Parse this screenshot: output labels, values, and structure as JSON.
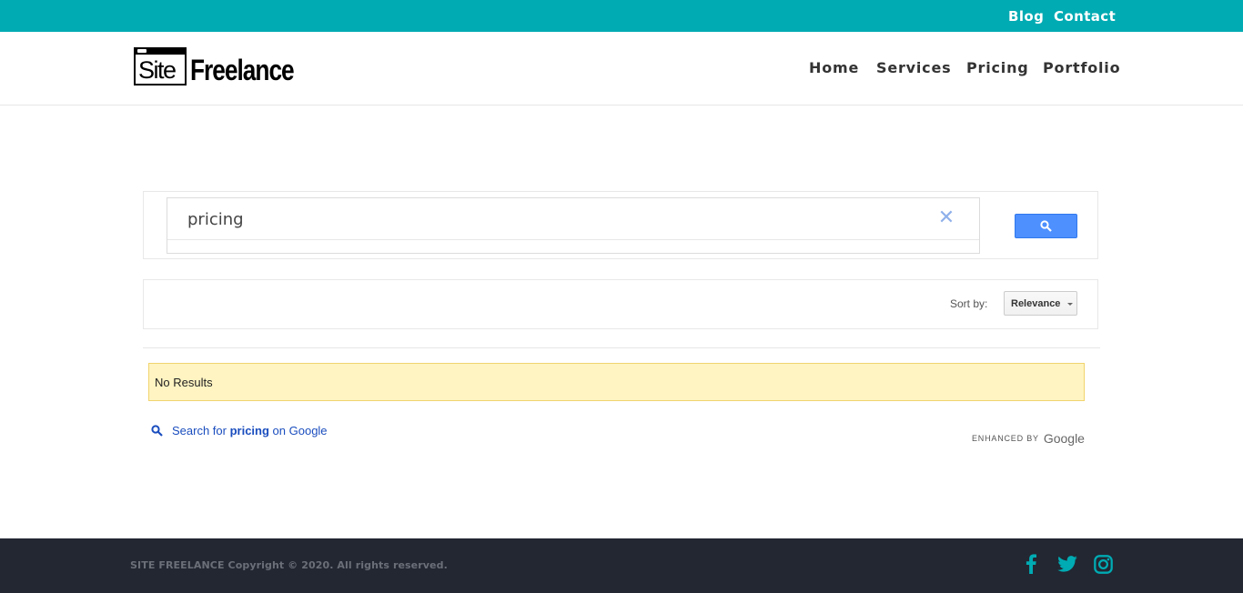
{
  "topbar": {
    "blog": "Blog",
    "contact": "Contact"
  },
  "logo": {
    "site": "Site",
    "freelance": "Freelance"
  },
  "nav": {
    "home": "Home",
    "services": "Services",
    "pricing": "Pricing",
    "portfolio": "Portfolio"
  },
  "search": {
    "value": "pricing",
    "clear_icon": "close-icon",
    "button_icon": "search-icon"
  },
  "sort": {
    "label": "Sort by:",
    "selected": "Relevance"
  },
  "results": {
    "message": "No Results"
  },
  "google_link": {
    "prefix": "Search for ",
    "query": "pricing",
    "suffix": " on Google"
  },
  "branding": {
    "enhanced": "ENHANCED BY",
    "google": "Google"
  },
  "footer": {
    "copyright": "SITE FREELANCE Copyright © 2020. All rights reserved.",
    "icons": [
      "facebook-icon",
      "twitter-icon",
      "instagram-icon"
    ]
  },
  "colors": {
    "accent": "#00abb3",
    "footer_bg": "#222732",
    "search_button": "#4d90fe",
    "notice_bg": "#fff4c2"
  }
}
